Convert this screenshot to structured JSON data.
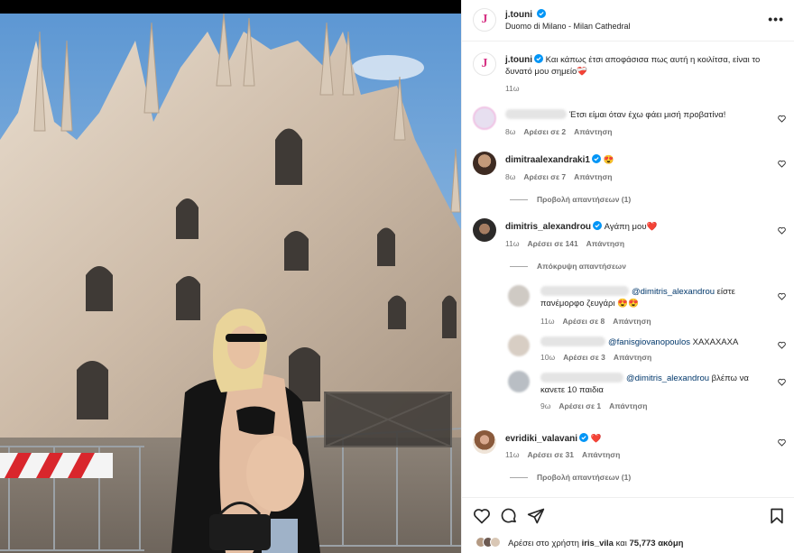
{
  "post": {
    "username": "j.touni",
    "location": "Duomo di Milano - Milan Cathedral",
    "avatar_letter": "J",
    "caption": "Και κάπως έτσι αποφάσισα πως αυτή η κοιλίτσα, είναι το δυνατό μου σημείο",
    "caption_emoji": "❤️‍🩹",
    "caption_time": "11ω",
    "more_label": "•••",
    "likes_prefix": "Αρέσει στο χρήστη",
    "likes_user": "iris_vila",
    "likes_and": "και",
    "likes_count": "75,773 ακόμη"
  },
  "comments": [
    {
      "text": "Έτσι είμαι όταν έχω φάει μισή προβατίνα!",
      "time": "8ω",
      "likes": "Αρέσει σε 2",
      "reply": "Απάντηση"
    },
    {
      "username": "dimitraalexandraki1",
      "text": "😍",
      "time": "8ω",
      "likes": "Αρέσει σε 7",
      "reply": "Απάντηση",
      "toggle": "Προβολή απαντήσεων (1)"
    },
    {
      "username": "dimitris_alexandrou",
      "text": "Αγάπη μου",
      "emoji": "❤️",
      "time": "11ω",
      "likes": "Αρέσει σε 141",
      "reply": "Απάντηση",
      "toggle": "Απόκρυψη απαντήσεων"
    }
  ],
  "replies": [
    {
      "mention": "@dimitris_alexandrou",
      "text": "είστε πανέμορφο ζευγάρι 😍😍",
      "time": "11ω",
      "likes": "Αρέσει σε 8",
      "reply": "Απάντηση"
    },
    {
      "mention": "@fanisgiovanopoulos",
      "text": "ΧΑΧΑΧΑΧΑ",
      "time": "10ω",
      "likes": "Αρέσει σε 3",
      "reply": "Απάντηση"
    },
    {
      "mention": "@dimitris_alexandrou",
      "text": "βλέπω να κανετε 10 παιδια",
      "time": "9ω",
      "likes": "Αρέσει σε 1",
      "reply": "Απάντηση"
    }
  ],
  "last_comment": {
    "username": "evridiki_valavani",
    "emoji": "❤️",
    "time": "11ω",
    "likes": "Αρέσει σε 31",
    "reply": "Απάντηση",
    "toggle": "Προβολή απαντήσεων (1)"
  },
  "icons": [
    "heart-icon",
    "comment-icon",
    "share-icon",
    "bookmark-icon",
    "verified-icon",
    "more-icon"
  ],
  "colors": {
    "verified": "#0095f6",
    "heart_red": "#ed4956",
    "link": "#00376b",
    "muted": "#737373"
  }
}
